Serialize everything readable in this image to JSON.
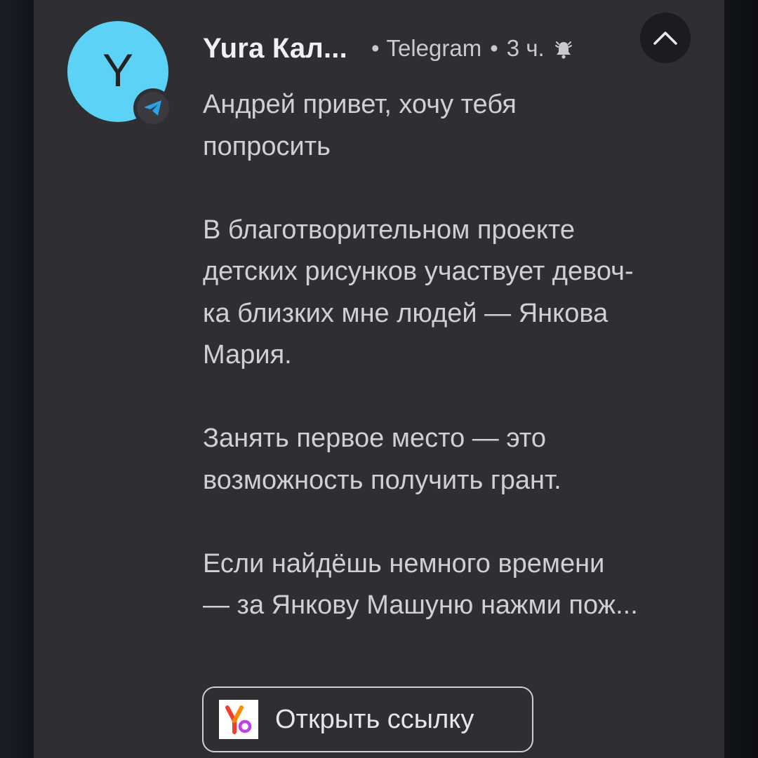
{
  "notification": {
    "avatar_letter": "Y",
    "sender": "Yura Кал...",
    "app_name": "Telegram",
    "separator": "•",
    "time": "3 ч.",
    "icons": {
      "app_badge": "telegram-icon",
      "alert": "bell-icon",
      "collapse": "chevron-up-icon",
      "browser": "yandex-browser-icon"
    },
    "message_lines": [
      "Андрей привет, хочу тебя",
      "попросить",
      "",
      "В благотворительном проекте",
      "детских рисунков участвует девоч-",
      "ка близких мне людей — Янкова",
      "Мария.",
      "",
      "Занять первое место — это",
      "возможность получить грант.",
      "",
      "Если найдёшь немного времени",
      "— за Янкову Машуню нажми пож..."
    ],
    "action_button_label": "Открыть ссылку"
  },
  "colors": {
    "avatar": "#5cd3f6",
    "card": "#2f2e33",
    "telegram": "#2aa3e4",
    "text_primary": "#f1f1f3",
    "text_secondary": "#cfcfd4"
  }
}
